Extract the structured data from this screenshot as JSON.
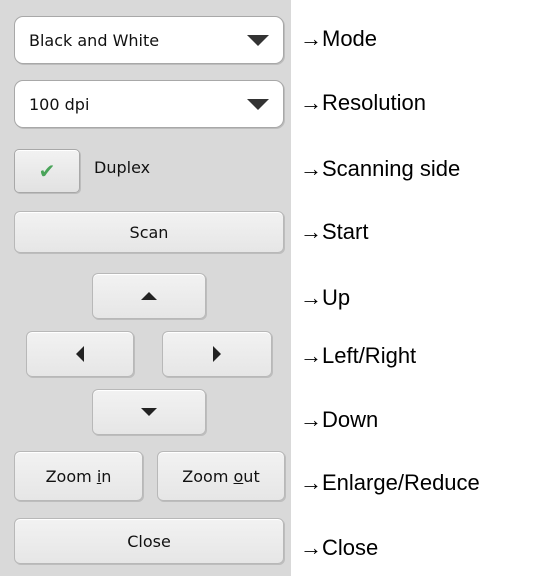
{
  "controls": {
    "mode_value": "Black and White",
    "resolution_value": "100 dpi",
    "duplex_label": "Duplex",
    "duplex_checked": true,
    "scan_label": "Scan",
    "zoom_in": {
      "before": "Zoom ",
      "underlined": "i",
      "after": "n"
    },
    "zoom_out": {
      "before": "Zoom ",
      "underlined": "o",
      "after": "ut"
    },
    "close_label": "Close"
  },
  "annotations": {
    "mode": "→Mode",
    "resolution": "→Resolution",
    "side": "→Scanning side",
    "start": "→Start",
    "up": "→Up",
    "left_right": "→Left/Right",
    "down": "→Down",
    "zoom": "→Enlarge/Reduce",
    "close": "→Close"
  },
  "icons": {
    "checkmark": "checkmark-icon",
    "arrow_up": "up-arrow-icon",
    "arrow_down": "down-arrow-icon",
    "arrow_left": "left-arrow-icon",
    "arrow_right": "right-arrow-icon",
    "dropdown": "chevron-down-icon"
  }
}
